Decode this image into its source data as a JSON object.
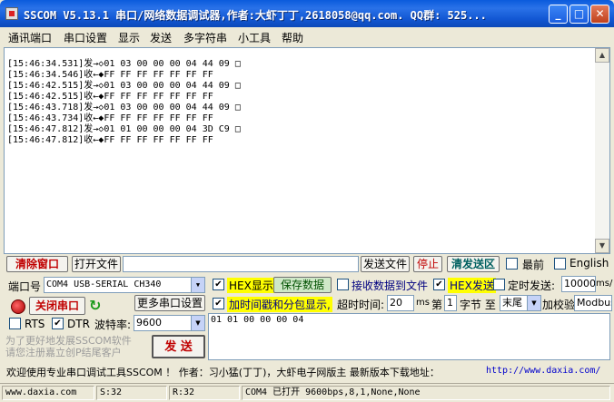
{
  "window": {
    "title": "SSCOM V5.13.1 串口/网络数据调试器,作者:大虾丁丁,2618058@qq.com. QQ群: 525...",
    "minimize": "_",
    "maximize": "□",
    "close": "✕"
  },
  "menu": [
    "通讯端口",
    "串口设置",
    "显示",
    "发送",
    "多字符串",
    "小工具",
    "帮助"
  ],
  "log": [
    "[15:46:34.531]发→◇01 03 00 00 00 04 44 09 □",
    "[15:46:34.546]收←◆FF FF FF FF FF FF FF",
    "[15:46:42.515]发→◇01 03 00 00 00 04 44 09 □",
    "[15:46:42.515]收←◆FF FF FF FF FF FF FF",
    "[15:46:43.718]发→◇01 03 00 00 00 04 44 09 □",
    "[15:46:43.734]收←◆FF FF FF FF FF FF FF",
    "[15:46:47.812]发→◇01 01 00 00 00 04 3D C9 □",
    "[15:46:47.812]收←◆FF FF FF FF FF FF FF"
  ],
  "toolbar": {
    "clear_window": "清除窗口",
    "open_file": "打开文件",
    "send_file": "发送文件",
    "stop": "停止",
    "clear_send": "清发送区",
    "topmost": "最前",
    "english": "English"
  },
  "port": {
    "port_label": "端口号",
    "port_value": "COM4 USB-SERIAL CH340",
    "close_port": "关闭串口",
    "more_settings": "更多串口设置",
    "rts": "RTS",
    "dtr": "DTR",
    "baud_label": "波特率:",
    "baud_value": "9600"
  },
  "options": {
    "hex_display": "HEX显示",
    "save_data": "保存数据",
    "recv_to_file": "接收数据到文件",
    "hex_send": "HEX发送",
    "timed_send": "定时发送:",
    "interval": "10000",
    "interval_unit": "ms/",
    "timestamp": "加时间戳和分包显示,",
    "timeout_label": "超时时间:",
    "timeout_value": "20",
    "timeout_unit": "ms",
    "nth": "第",
    "byte_from": "1",
    "byte_label": "字节 至",
    "byte_to": "末尾",
    "checksum_label": "加校验",
    "checksum_value": "Modbus"
  },
  "send": {
    "promo": "为了更好地发展SSCOM软件\n请您注册嘉立创P结尾客户",
    "send_button": "发  送",
    "text": "01 01 00 00 00 04"
  },
  "ticker": {
    "text": "欢迎使用专业串口调试工具SSCOM ！  作者：习小猛(丁丁)，大虾电子网版主  最新版本下载地址：",
    "url": "http://www.daxia.com/"
  },
  "status": {
    "site": "www.daxia.com",
    "sent": "S:32",
    "received": "R:32",
    "port_state": "COM4 已打开  9600bps,8,1,None,None"
  }
}
